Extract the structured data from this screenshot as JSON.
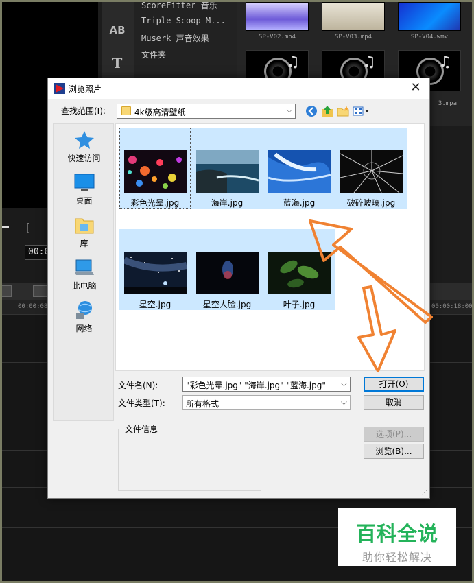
{
  "background": {
    "menu_items": [
      "ScoreFitter 音乐",
      "Triple Scoop M...",
      "Muserk 声音效果",
      "文件夹"
    ],
    "side_icons": [
      "AB",
      "T"
    ],
    "clips": [
      "SP-V02.mp4",
      "SP-V03.mp4",
      "SP-V04.wmv"
    ],
    "partial_clip_label": "3.mpa",
    "timecode": "00:0",
    "ruler_left": "00:00:08",
    "ruler_right": "00:00:18:00"
  },
  "dialog": {
    "title": "浏览照片",
    "close_symbol": "✕",
    "lookin_label": "查找范围(I):",
    "lookin_value": "4k级高清壁纸",
    "places": [
      {
        "label": "快速访问",
        "icon": "star-icon"
      },
      {
        "label": "桌面",
        "icon": "desktop-icon"
      },
      {
        "label": "库",
        "icon": "library-icon"
      },
      {
        "label": "此电脑",
        "icon": "computer-icon"
      },
      {
        "label": "网络",
        "icon": "network-icon"
      }
    ],
    "files": [
      {
        "name": "彩色光晕.jpg",
        "image": "bokeh-image"
      },
      {
        "name": "海岸.jpg",
        "image": "coast-image"
      },
      {
        "name": "蓝海.jpg",
        "image": "blue-sea-image"
      },
      {
        "name": "破碎玻璃.jpg",
        "image": "broken-glass-image"
      },
      {
        "name": "星空.jpg",
        "image": "starry-sky-image"
      },
      {
        "name": "星空人脸.jpg",
        "image": "starry-face-image"
      },
      {
        "name": "叶子.jpg",
        "image": "leaves-image"
      }
    ],
    "filename_label": "文件名(N):",
    "filename_value": "\"彩色光晕.jpg\" \"海岸.jpg\" \"蓝海.jpg\"",
    "filetype_label": "文件类型(T):",
    "filetype_value": "所有格式",
    "open_label": "打开(O)",
    "cancel_label": "取消",
    "options_label": "选项(P)...",
    "browse_label": "浏览(B)...",
    "file_info_label": "文件信息",
    "dropdown_arrow": "⌵"
  },
  "watermark": {
    "title": "百科全说",
    "subtitle": "助你轻松解决"
  },
  "colors": {
    "selection": "#cce8ff",
    "accent": "#0078d7",
    "arrow": "#f08232",
    "watermark_green": "#24b35a"
  }
}
